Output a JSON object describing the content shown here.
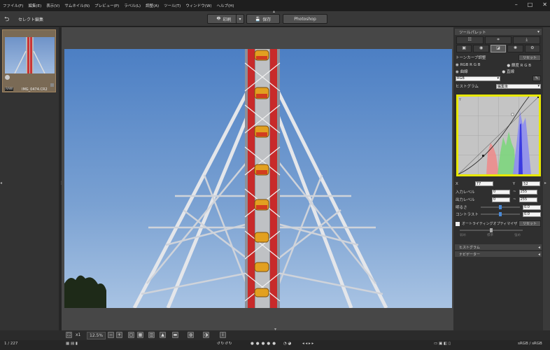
{
  "menu": [
    "ファイル(F)",
    "編集(E)",
    "表示(V)",
    "サムネイル(N)",
    "プレビュー(P)",
    "ラベル(L)",
    "調整(A)",
    "ツール(T)",
    "ウィンドウ(W)",
    "ヘルプ(H)"
  ],
  "toolbar": {
    "mode": "セレクト編集",
    "print": "印刷",
    "save": "保存",
    "photoshop": "Photoshop"
  },
  "thumb": {
    "filename": "IMG_0474.CR2",
    "badge": "RAW"
  },
  "palette": {
    "title": "ツールパレット",
    "section": "トーンカーブ調整",
    "reset": "リセット",
    "radio1": "RGB R G B",
    "radio2": "輝度 R G B",
    "radio3": "曲線",
    "radio4": "直線",
    "channel": "RGB",
    "histlabel": "ヒストグラム",
    "histmode": "編集後",
    "x_label": "X",
    "x_value": "77",
    "y_label": "Y",
    "y_value": "52",
    "inlevel": "入力レベル",
    "in_lo": "0",
    "in_hi": "255",
    "outlevel": "出力レベル",
    "out_lo": "0",
    "out_hi": "255",
    "brightness": "明るさ",
    "brightness_value": "0.0",
    "contrast": "コントラスト",
    "contrast_value": "0.0",
    "alo": "オートライティングオプティマイザ",
    "alo_reset": "リセット",
    "alo_l1": "弱め",
    "alo_l2": "標準",
    "alo_l3": "強め",
    "panel_hist": "ヒストグラム",
    "panel_navi": "ナビゲーター"
  },
  "viewer": {
    "zoom": "12.5%",
    "zoom_one": "x1"
  },
  "status": {
    "count": "1 / 227",
    "colorspace": "sRGB / sRGB"
  },
  "colors": {
    "accent": "#e8e800",
    "bg": "#2b2b2b"
  }
}
